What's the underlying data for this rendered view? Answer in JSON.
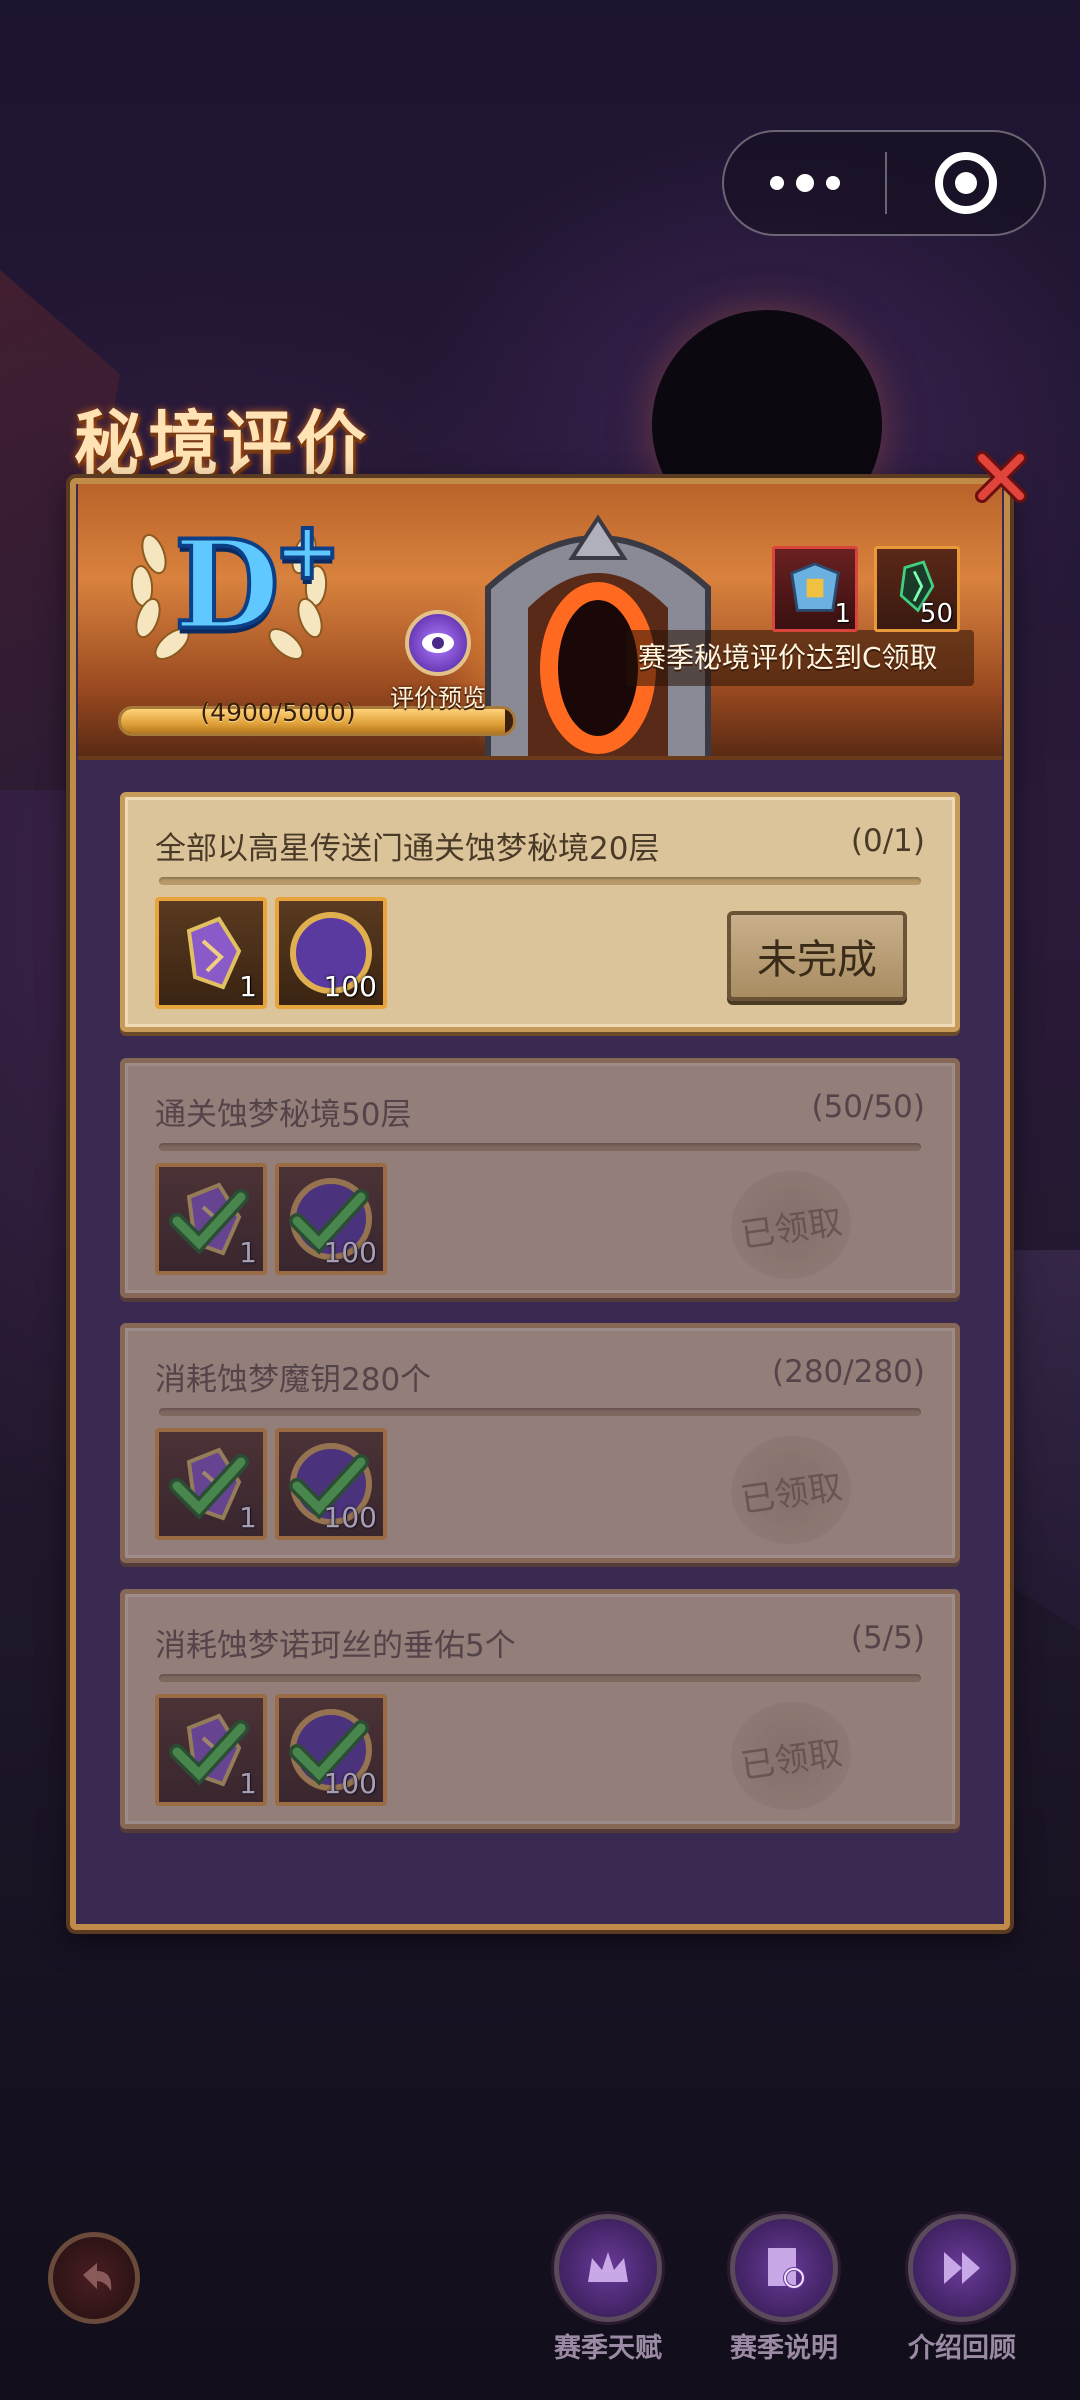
{
  "capsule": {
    "more_icon": "more-dots-icon",
    "close_icon": "target-ring-icon"
  },
  "page": {
    "title": "秘境评价"
  },
  "header": {
    "rank": "D",
    "rank_plus": "+",
    "progress": {
      "current": 4900,
      "max": 5000,
      "text": "(4900/5000)"
    },
    "preview_label": "评价预览",
    "reward_text": "赛季秘境评价达到C领取",
    "rewards": [
      {
        "icon": "armor-chest-icon",
        "qty": "1"
      },
      {
        "icon": "green-crystal-icon",
        "qty": "50"
      }
    ]
  },
  "tasks": [
    {
      "title": "全部以高星传送门通关蚀梦秘境20层",
      "count": "(0/1)",
      "completed": false,
      "status_label": "未完成",
      "items": [
        {
          "icon": "purple-shard-icon",
          "qty": "1"
        },
        {
          "icon": "moon-coin-icon",
          "qty": "100"
        }
      ]
    },
    {
      "title": "通关蚀梦秘境50层",
      "count": "(50/50)",
      "completed": true,
      "status_label": "已领取",
      "items": [
        {
          "icon": "purple-shard-icon",
          "qty": "1"
        },
        {
          "icon": "moon-coin-icon",
          "qty": "100"
        }
      ]
    },
    {
      "title": "消耗蚀梦魔钥280个",
      "count": "(280/280)",
      "completed": true,
      "status_label": "已领取",
      "items": [
        {
          "icon": "purple-shard-icon",
          "qty": "1"
        },
        {
          "icon": "moon-coin-icon",
          "qty": "100"
        }
      ]
    },
    {
      "title": "消耗蚀梦诺珂丝的垂佑5个",
      "count": "(5/5)",
      "completed": true,
      "status_label": "已领取",
      "items": [
        {
          "icon": "purple-shard-icon",
          "qty": "1"
        },
        {
          "icon": "moon-coin-icon",
          "qty": "100"
        }
      ]
    }
  ],
  "bottom_nav": [
    {
      "label": "赛季天赋",
      "icon": "crown-icon"
    },
    {
      "label": "赛季说明",
      "icon": "document-search-icon"
    },
    {
      "label": "介绍回顾",
      "icon": "fast-forward-icon"
    }
  ],
  "colors": {
    "accent": "#c08a48",
    "card_bg": "#dcc49a",
    "rank_blue": "#5ec8ff"
  }
}
